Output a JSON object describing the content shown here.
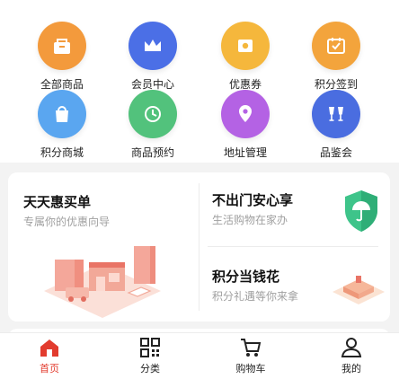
{
  "grid": [
    {
      "label": "全部商品",
      "icon": "shop-bag-icon",
      "color": "#f39a3c"
    },
    {
      "label": "会员中心",
      "icon": "crown-icon",
      "color": "#4b6fe6"
    },
    {
      "label": "优惠券",
      "icon": "coupon-icon",
      "color": "#f5b73c"
    },
    {
      "label": "积分签到",
      "icon": "calendar-check-icon",
      "color": "#f3a43c"
    },
    {
      "label": "积分商城",
      "icon": "shopping-bag-icon",
      "color": "#5aa6f0"
    },
    {
      "label": "商品预约",
      "icon": "clock-icon",
      "color": "#52c27c"
    },
    {
      "label": "地址管理",
      "icon": "location-person-icon",
      "color": "#b462e4"
    },
    {
      "label": "品鉴会",
      "icon": "wine-glasses-icon",
      "color": "#4a6de0"
    }
  ],
  "promo": {
    "left": {
      "title": "天天惠买单",
      "subtitle": "专属你的优惠向导"
    },
    "right_top": {
      "title": "不出门安心享",
      "subtitle": "生活购物在家办"
    },
    "right_bottom": {
      "title": "积分当钱花",
      "subtitle": "积分礼遇等你来拿"
    }
  },
  "tabs": [
    {
      "label": "首页",
      "icon": "home-icon",
      "active": true
    },
    {
      "label": "分类",
      "icon": "qr-grid-icon",
      "active": false
    },
    {
      "label": "购物车",
      "icon": "cart-icon",
      "active": false
    },
    {
      "label": "我的",
      "icon": "user-icon",
      "active": false
    }
  ],
  "colors": {
    "accent": "#e23b2e",
    "shield": "#3ec48a",
    "promo_illustration": "#f2a898"
  }
}
